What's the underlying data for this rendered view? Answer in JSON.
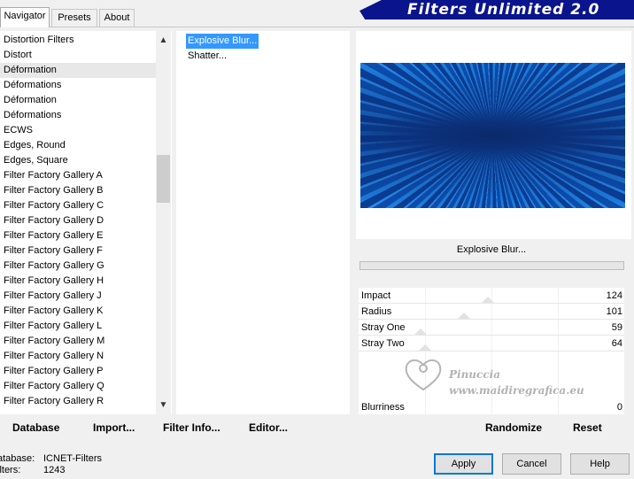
{
  "tabs": [
    "Navigator",
    "Presets",
    "About"
  ],
  "banner_title": "Filters Unlimited 2.0",
  "categories": [
    "Distortion Filters",
    "Distort",
    "Déformation",
    "Déformations",
    "Déformation",
    "Déformations",
    "ECWS",
    "Edges, Round",
    "Edges, Square",
    "Filter Factory Gallery A",
    "Filter Factory Gallery B",
    "Filter Factory Gallery C",
    "Filter Factory Gallery D",
    "Filter Factory Gallery E",
    "Filter Factory Gallery F",
    "Filter Factory Gallery G",
    "Filter Factory Gallery H",
    "Filter Factory Gallery J",
    "Filter Factory Gallery K",
    "Filter Factory Gallery L",
    "Filter Factory Gallery M",
    "Filter Factory Gallery N",
    "Filter Factory Gallery P",
    "Filter Factory Gallery Q",
    "Filter Factory Gallery R"
  ],
  "selected_category_index": 2,
  "filters": [
    "Explosive Blur...",
    "Shatter..."
  ],
  "selected_filter": "Explosive Blur...",
  "filter_name_label": "Explosive Blur...",
  "params": [
    {
      "label": "Impact",
      "value": "124"
    },
    {
      "label": "Radius",
      "value": "101"
    },
    {
      "label": "Stray One",
      "value": "59"
    },
    {
      "label": "Stray Two",
      "value": "64"
    },
    {
      "label": "Blurriness",
      "value": "0"
    }
  ],
  "watermark": {
    "line1": "Pinuccia",
    "line2": "www.maidiregrafica.eu"
  },
  "bottom": {
    "database": "Database",
    "import": "Import...",
    "filter_info": "Filter Info...",
    "editor": "Editor...",
    "randomize": "Randomize",
    "reset": "Reset"
  },
  "status": {
    "database_key": "atabase:",
    "database_value": "ICNET-Filters",
    "filters_key": "ilters:",
    "filters_value": "1243"
  },
  "dialog_buttons": {
    "apply": "Apply",
    "cancel": "Cancel",
    "help": "Help"
  },
  "colors": {
    "banner": "#0a148c",
    "selection": "#3399ff",
    "preview_blue": "#1e7fe0"
  }
}
